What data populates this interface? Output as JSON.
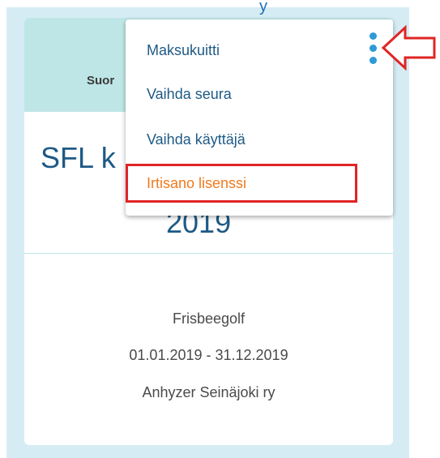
{
  "header": {
    "label_partial": "Suor",
    "top_cutoff": "y"
  },
  "card": {
    "title_partial": "SFL k",
    "year_partial": "2019",
    "sport": "Frisbeegolf",
    "validity": "01.01.2019 - 31.12.2019",
    "club": "Anhyzer Seinäjoki ry"
  },
  "menu": {
    "items": [
      {
        "label": "Maksukuitti"
      },
      {
        "label": "Vaihda seura"
      },
      {
        "label": "Vaihda käyttäjä"
      },
      {
        "label": "Irtisano lisenssi"
      }
    ]
  },
  "icons": {
    "menu_trigger": "kebab-vertical-icon",
    "annotation": "arrow-left-icon"
  },
  "colors": {
    "primary_text": "#1e5a86",
    "danger_text": "#f07a1e",
    "header_bg": "#bfe6e6",
    "highlight": "#e02424",
    "accent": "#2e9ad8"
  }
}
